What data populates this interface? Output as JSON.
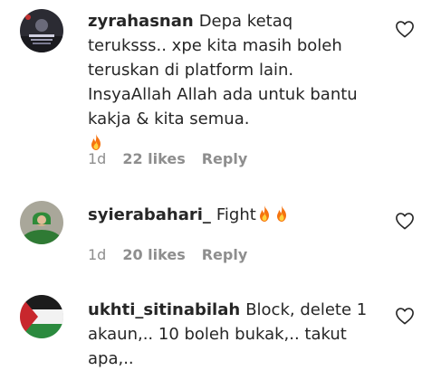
{
  "comments": [
    {
      "username": "zyrahasnan",
      "text": "Depa ketaq teruksss.. xpe kita masih boleh teruskan di platform lain. InsyaAllah Allah ada untuk bantu kakja & kita semua.",
      "emoji_count": 1,
      "emoji": "fire-emoji",
      "time": "1d",
      "likes": "22 likes",
      "reply": "Reply"
    },
    {
      "username": "syierabahari_",
      "text": "Fight",
      "emoji_count": 2,
      "emoji": "fire-emoji",
      "time": "1d",
      "likes": "20 likes",
      "reply": "Reply"
    },
    {
      "username": "ukhti_sitinabilah",
      "text": "Block, delete 1 akaun,.. 10 boleh bukak,.. takut apa,..",
      "emoji_count": 0,
      "time": "",
      "likes": "",
      "reply": ""
    }
  ],
  "colors": {
    "text": "#262626",
    "muted": "#8e8e8e",
    "heart_outline": "#262626"
  },
  "icons": {
    "like": "heart-outline-icon"
  }
}
